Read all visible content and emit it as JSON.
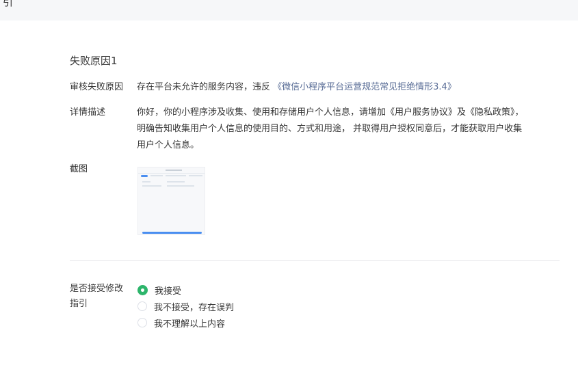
{
  "top_bar": {
    "glyph": "引"
  },
  "section": {
    "title": "失败原因1"
  },
  "rows": {
    "reason": {
      "label": "审核失败原因",
      "text": "存在平台未允许的服务内容，违反",
      "link": "《微信小程序平台运营规范常见拒绝情形3.4》"
    },
    "detail": {
      "label": "详情描述",
      "line1": "你好，你的小程序涉及收集、使用和存储用户个人信息，请增加《用户服务协议》及《隐私政策》，",
      "line2": "明确告知收集用户个人信息的使用目的、方式和用途， 并取得用户授权同意后，才能获取用户收集",
      "line3": "用户个人信息。"
    },
    "screenshot": {
      "label": "截图"
    }
  },
  "accept": {
    "label_line1": "是否接受修改",
    "label_line2": "指引",
    "options": [
      {
        "label": "我接受",
        "checked": true
      },
      {
        "label": "我不接受，存在误判",
        "checked": false
      },
      {
        "label": "我不理解以上内容",
        "checked": false
      }
    ]
  },
  "colors": {
    "link": "#576b95",
    "radio_checked": "#2db56b",
    "top_bar_bg": "#f6f7f9",
    "divider": "#e7e7eb"
  }
}
